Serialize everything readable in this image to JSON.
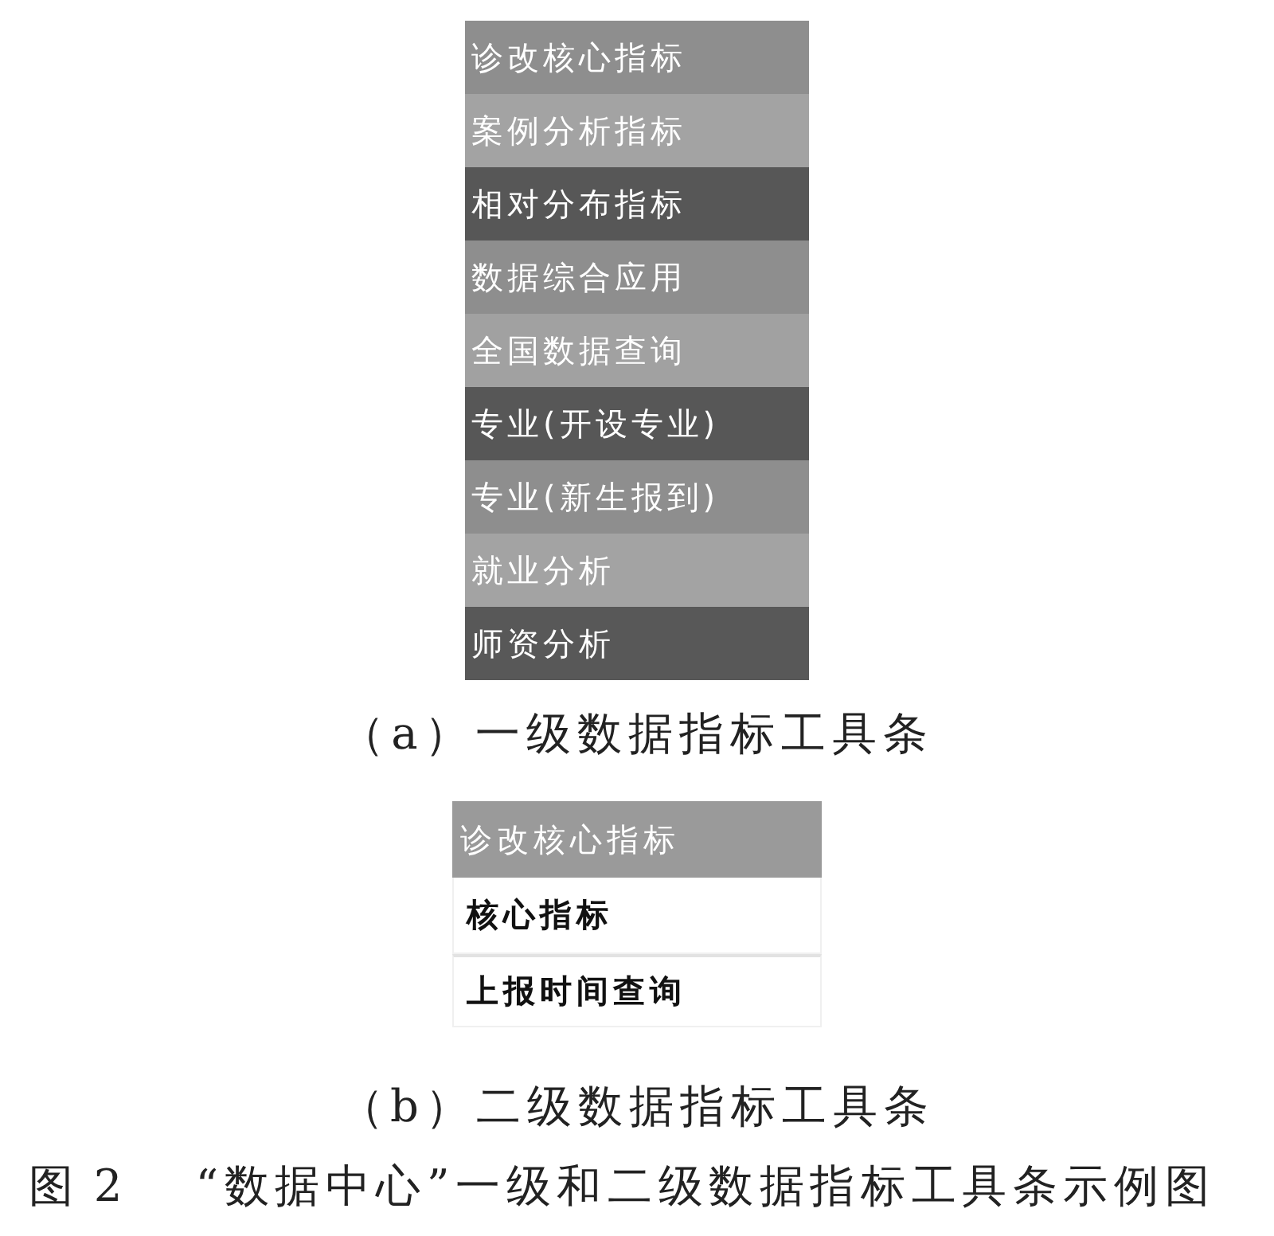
{
  "panel_a": {
    "items": [
      {
        "label": "诊改核心指标",
        "color": "#8e8e8e"
      },
      {
        "label": "案例分析指标",
        "color": "#a3a3a3"
      },
      {
        "label": "相对分布指标",
        "color": "#575757"
      },
      {
        "label": "数据综合应用",
        "color": "#8e8e8e"
      },
      {
        "label": "全国数据查询",
        "color": "#a1a1a1"
      },
      {
        "label": "专业(开设专业)",
        "color": "#575757"
      },
      {
        "label": "专业(新生报到)",
        "color": "#8e8e8e"
      },
      {
        "label": "就业分析",
        "color": "#a3a3a3"
      },
      {
        "label": "师资分析",
        "color": "#585858"
      }
    ],
    "caption": "（a）一级数据指标工具条"
  },
  "panel_b": {
    "header": "诊改核心指标",
    "items": [
      {
        "label": "核心指标"
      },
      {
        "label": "上报时间查询"
      }
    ],
    "caption": "（b）二级数据指标工具条"
  },
  "figure_caption": {
    "number": "图 2",
    "title": "“数据中心”一级和二级数据指标工具条示例图"
  }
}
